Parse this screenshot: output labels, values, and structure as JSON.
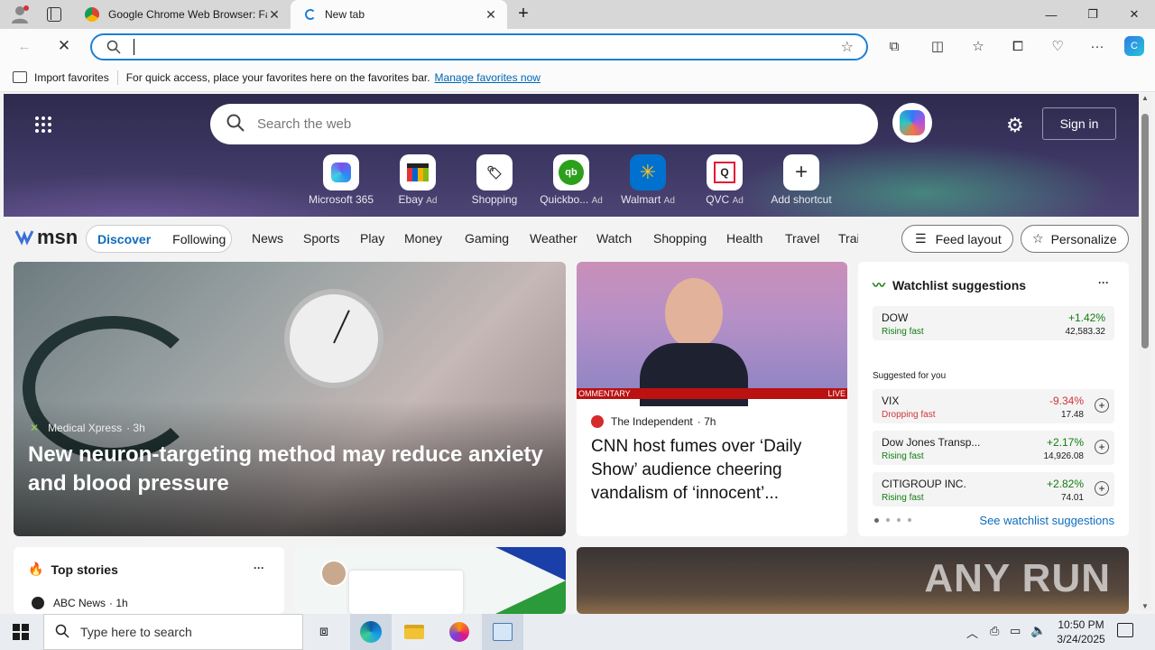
{
  "browser": {
    "tabs": [
      {
        "title": "Google Chrome Web Browser: Fa",
        "favicon": "chrome-icon"
      },
      {
        "title": "New tab",
        "favicon": "edge-loading-icon"
      }
    ],
    "address_value": "",
    "fav_bar": {
      "import_label": "Import favorites",
      "message": "For quick access, place your favorites here on the favorites bar.",
      "manage_link": "Manage favorites now"
    }
  },
  "hero": {
    "search_placeholder": "Search the web",
    "sign_in": "Sign in",
    "shortcuts": [
      {
        "label": "Microsoft 365",
        "ad": ""
      },
      {
        "label": "Ebay",
        "ad": "Ad"
      },
      {
        "label": "Shopping",
        "ad": ""
      },
      {
        "label": "Quickbo...",
        "ad": "Ad"
      },
      {
        "label": "Walmart",
        "ad": "Ad"
      },
      {
        "label": "QVC",
        "ad": "Ad"
      },
      {
        "label": "Add shortcut",
        "ad": ""
      }
    ]
  },
  "msn": {
    "logo": "msn",
    "tabs": [
      "Discover",
      "Following"
    ],
    "nav": [
      "News",
      "Sports",
      "Play",
      "Money",
      "Gaming",
      "Weather",
      "Watch",
      "Shopping",
      "Health",
      "Travel",
      "Trai"
    ],
    "feed_layout": "Feed layout",
    "personalize": "Personalize"
  },
  "main_story": {
    "source": "Medical Xpress",
    "age": "· 3h",
    "headline": "New neuron-targeting method may reduce anxiety and blood pressure"
  },
  "side_story": {
    "banner_left": "OMMENTARY",
    "banner_right": "LIVE",
    "source": "The Independent",
    "age": "· 7h",
    "headline": "CNN host fumes over ‘Daily Show’ audience cheering vandalism of ‘innocent’..."
  },
  "watchlist": {
    "title": "Watchlist suggestions",
    "more": "···",
    "featured": {
      "name": "DOW",
      "status": "Rising fast",
      "change": "+1.42%",
      "value": "42,583.32"
    },
    "suggested_label": "Suggested for you",
    "items": [
      {
        "name": "VIX",
        "status": "Dropping fast",
        "change": "-9.34%",
        "value": "17.48",
        "dir": "down"
      },
      {
        "name": "Dow Jones Transp...",
        "status": "Rising fast",
        "change": "+2.17%",
        "value": "14,926.08",
        "dir": "up"
      },
      {
        "name": "CITIGROUP INC.",
        "status": "Rising fast",
        "change": "+2.82%",
        "value": "74.01",
        "dir": "up"
      }
    ],
    "see_link": "See watchlist suggestions"
  },
  "top_stories": {
    "title": "Top stories",
    "more": "···",
    "first_source": "ABC News",
    "first_age": "· 1h"
  },
  "watermark": "ANY RUN",
  "taskbar": {
    "search_placeholder": "Type here to search",
    "time": "10:50 PM",
    "date": "3/24/2025"
  }
}
